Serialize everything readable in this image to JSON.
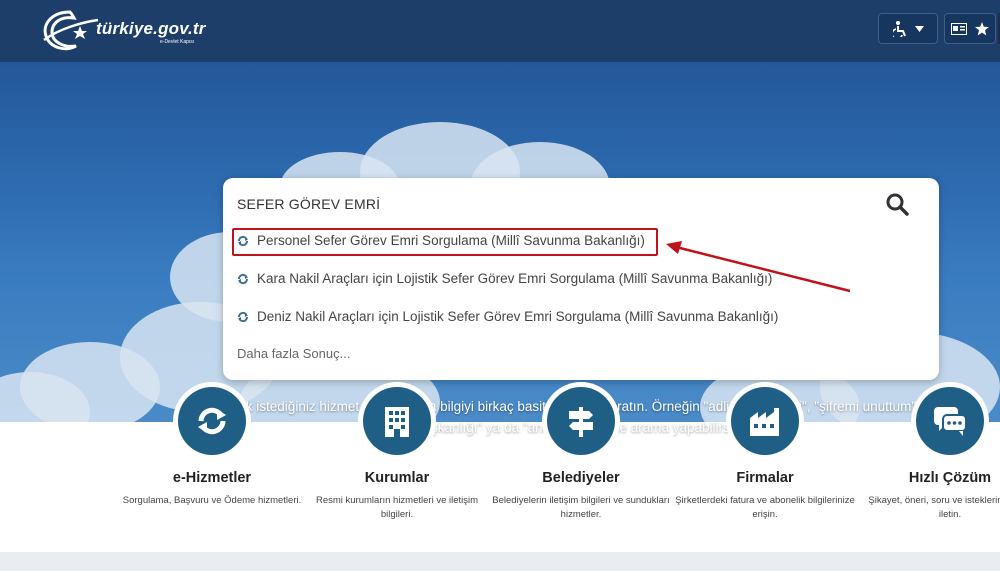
{
  "header": {
    "logo_text": "türkiye.gov.tr",
    "logo_subtext": "e-Devlet Kapısı",
    "accessibility_icon": "accessibility-icon",
    "dropdown_icon": "caret-down-icon",
    "idcard_icon": "id-card-icon",
    "star_icon": "star-icon"
  },
  "search": {
    "value": "SEFER GÖREV EMRİ",
    "icon": "search-icon",
    "results": [
      {
        "label": "Personel Sefer Görev Emri Sorgulama (Millî Savunma Bakanlığı)"
      },
      {
        "label": "Kara Nakil Araçları için Lojistik Sefer Görev Emri Sorgulama (Millî Savunma Bakanlığı)"
      },
      {
        "label": "Deniz Nakil Araçları için Lojistik Sefer Görev Emri Sorgulama (Millî Savunma Bakanlığı)"
      }
    ],
    "more_label": "Daha fazla Sonuç..."
  },
  "hint": "Ulaşmak istediğiniz hizmet, kurum veya bilgiyi birkaç basit kelime ile aratın. Örneğin \"adli sicil belgesi\", \"şifremi unuttum\", \"cumhurbaşkanlığı\" ya da \"ankara\" şeklinde arama yapabilirsiniz.",
  "cards": [
    {
      "title": "e-Hizmetler",
      "desc": "Sorgulama, Başvuru ve Ödeme hizmetleri.",
      "icon": "refresh-icon"
    },
    {
      "title": "Kurumlar",
      "desc": "Resmi kurumların hizmetleri ve iletişim bilgileri.",
      "icon": "building-icon"
    },
    {
      "title": "Belediyeler",
      "desc": "Belediyelerin iletişim bilgileri ve sundukları hizmetler.",
      "icon": "signpost-icon"
    },
    {
      "title": "Firmalar",
      "desc": "Şirketlerdeki fatura ve abonelik bilgilerinize erişin.",
      "icon": "factory-icon"
    },
    {
      "title": "Hızlı Çözüm",
      "desc": "Şikayet, öneri, soru ve isteklerinizi bize iletin.",
      "icon": "chat-icon"
    }
  ],
  "colors": {
    "header_bg": "#1d3e69",
    "circle_bg": "#1f5f86",
    "highlight": "#c0121a"
  }
}
